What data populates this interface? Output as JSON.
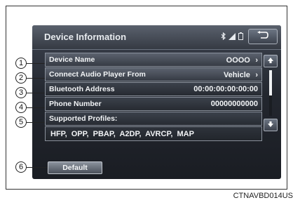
{
  "header": {
    "title": "Device Information"
  },
  "rows": [
    {
      "label": "Device Name",
      "value": "OOOO",
      "chevron": "›"
    },
    {
      "label": "Connect Audio Player From",
      "value": "Vehicle",
      "chevron": "›"
    },
    {
      "label": "Bluetooth Address",
      "value": "00:00:00:00:00:00"
    },
    {
      "label": "Phone Number",
      "value": "00000000000"
    },
    {
      "label": "Supported Profiles:"
    }
  ],
  "profiles": "HFP, OPP, PBAP, A2DP, AVRCP, MAP",
  "default_button": "Default",
  "callouts": [
    "1",
    "2",
    "3",
    "4",
    "5",
    "6"
  ],
  "caption": "CTNAVBD014US",
  "icons": {
    "status": [
      "bluetooth-icon",
      "signal-icon",
      "battery-icon"
    ],
    "back": "back-arrow-icon",
    "scroll_up": "scroll-up-icon",
    "scroll_down": "scroll-down-icon"
  }
}
